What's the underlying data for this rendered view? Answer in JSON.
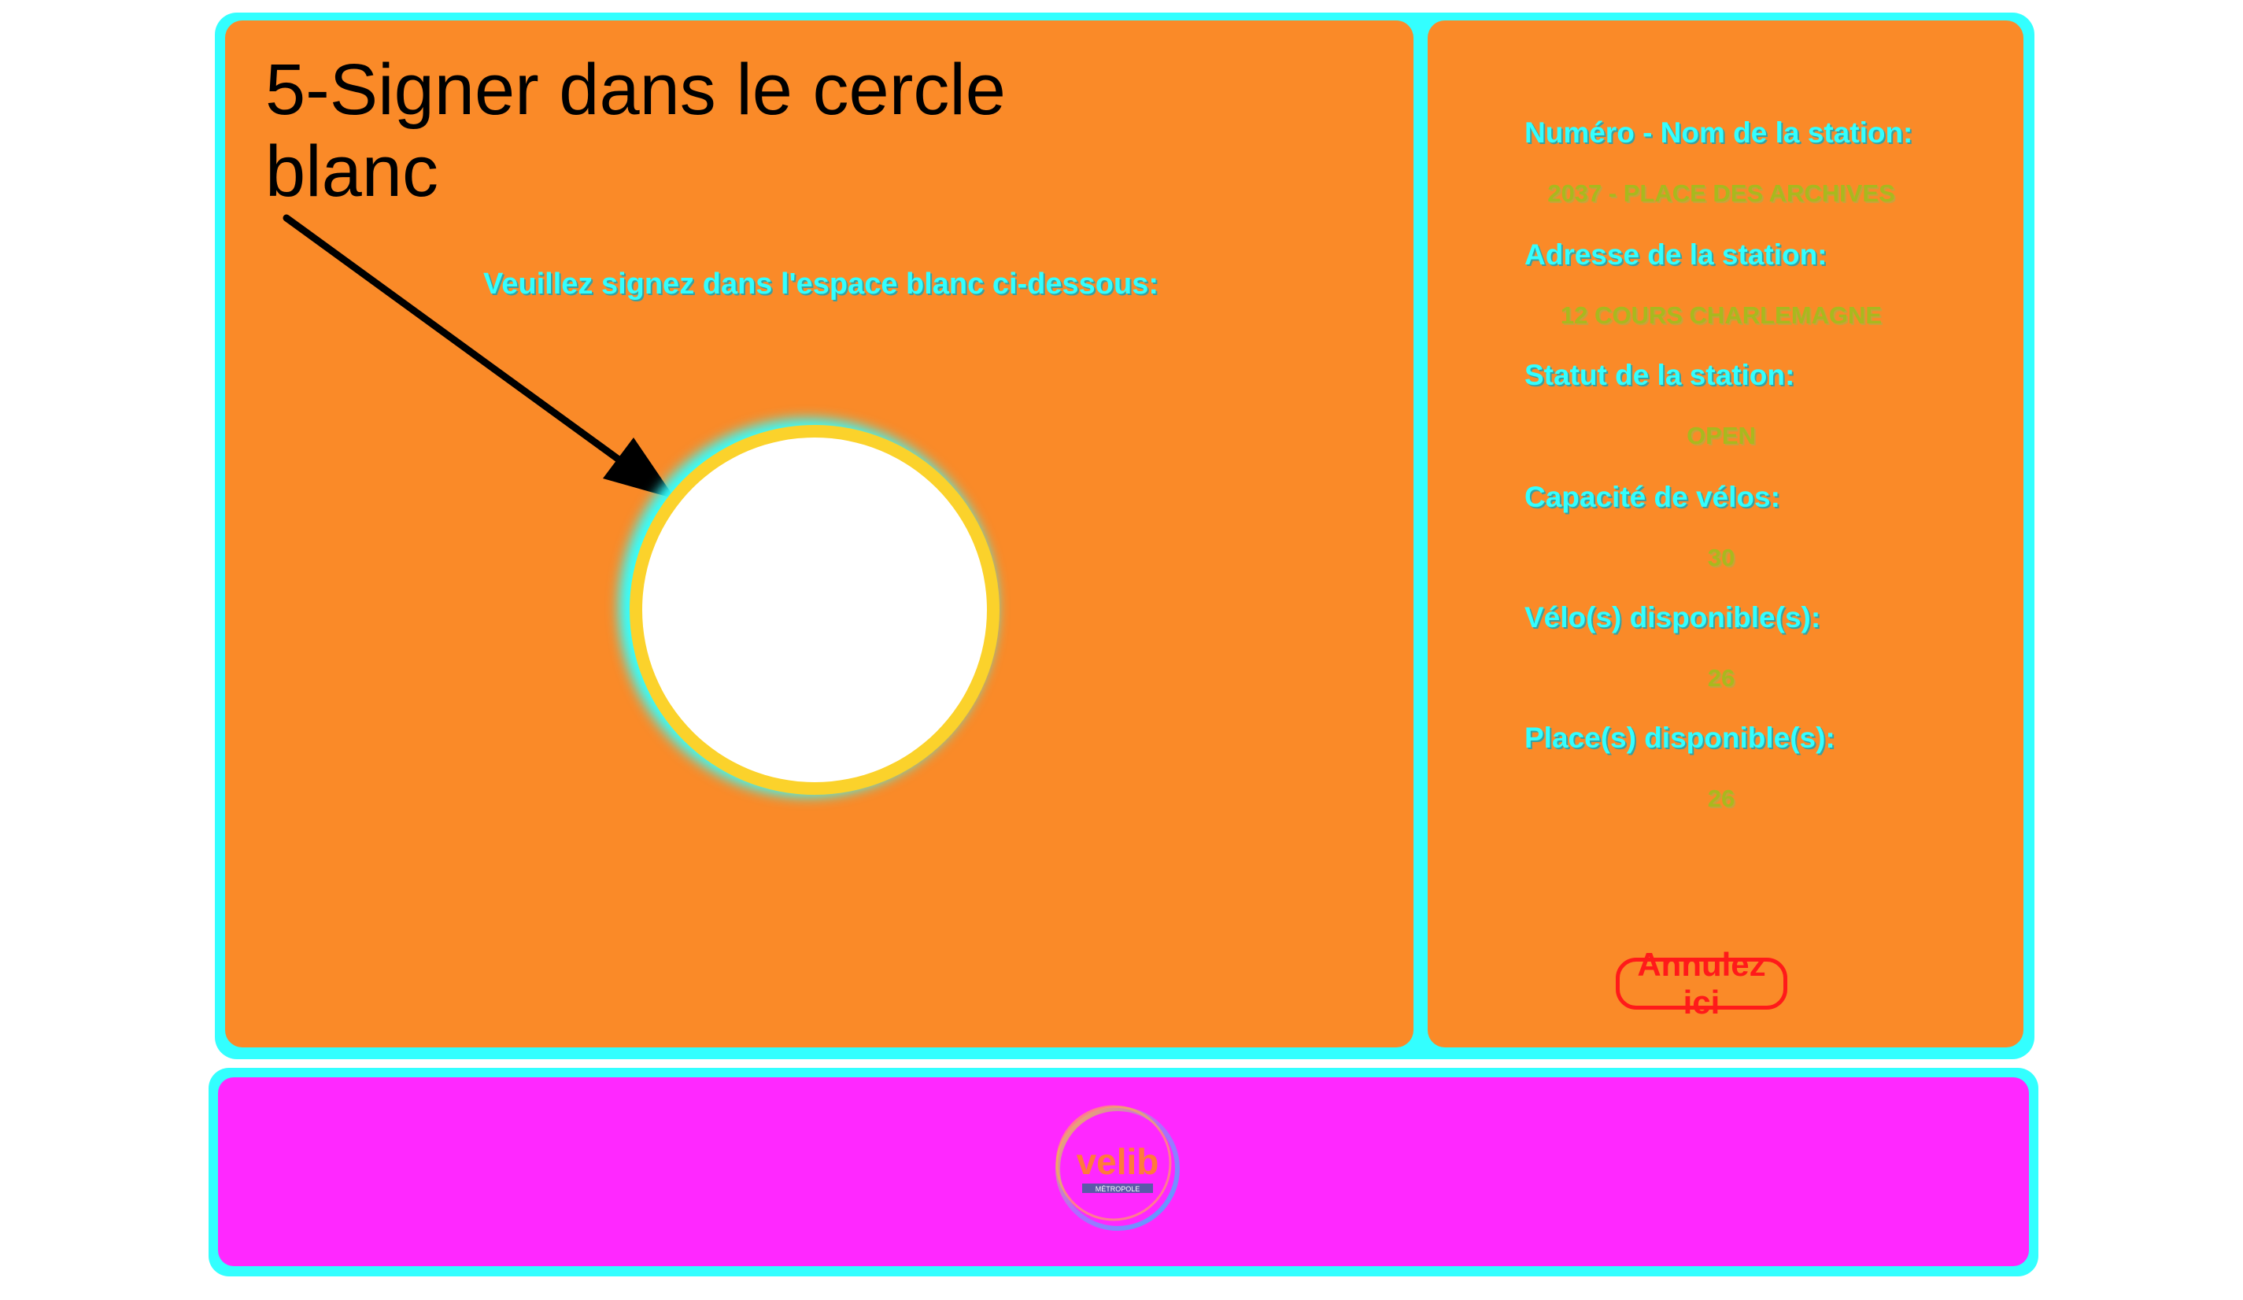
{
  "annotation": {
    "title": "5-Signer dans le cercle blanc"
  },
  "signature": {
    "prompt": "Veuillez signez dans l'espace blanc ci-dessous:"
  },
  "station": {
    "fields": [
      {
        "label": "Numéro - Nom de la station:",
        "value": "2037 - PLACE DES ARCHIVES"
      },
      {
        "label": "Adresse de la station:",
        "value": "12 COURS CHARLEMAGNE"
      },
      {
        "label": "Statut de la station:",
        "value": "OPEN"
      },
      {
        "label": "Capacité de vélos:",
        "value": "30"
      },
      {
        "label": "Vélo(s) disponible(s):",
        "value": "26"
      },
      {
        "label": "Place(s) disponible(s):",
        "value": "26"
      }
    ],
    "cancel_label": "Annulez ici"
  },
  "footer": {
    "logo_icon": "velib-logo-icon",
    "logo_text": "velib",
    "logo_subtext": "MÉTROPOLE"
  },
  "colors": {
    "frame": "#33ffff",
    "panel": "#fa8a28",
    "footer": "#ff28ff",
    "accent_red": "#ff1a1a",
    "circle_ring": "#fbd22b"
  }
}
